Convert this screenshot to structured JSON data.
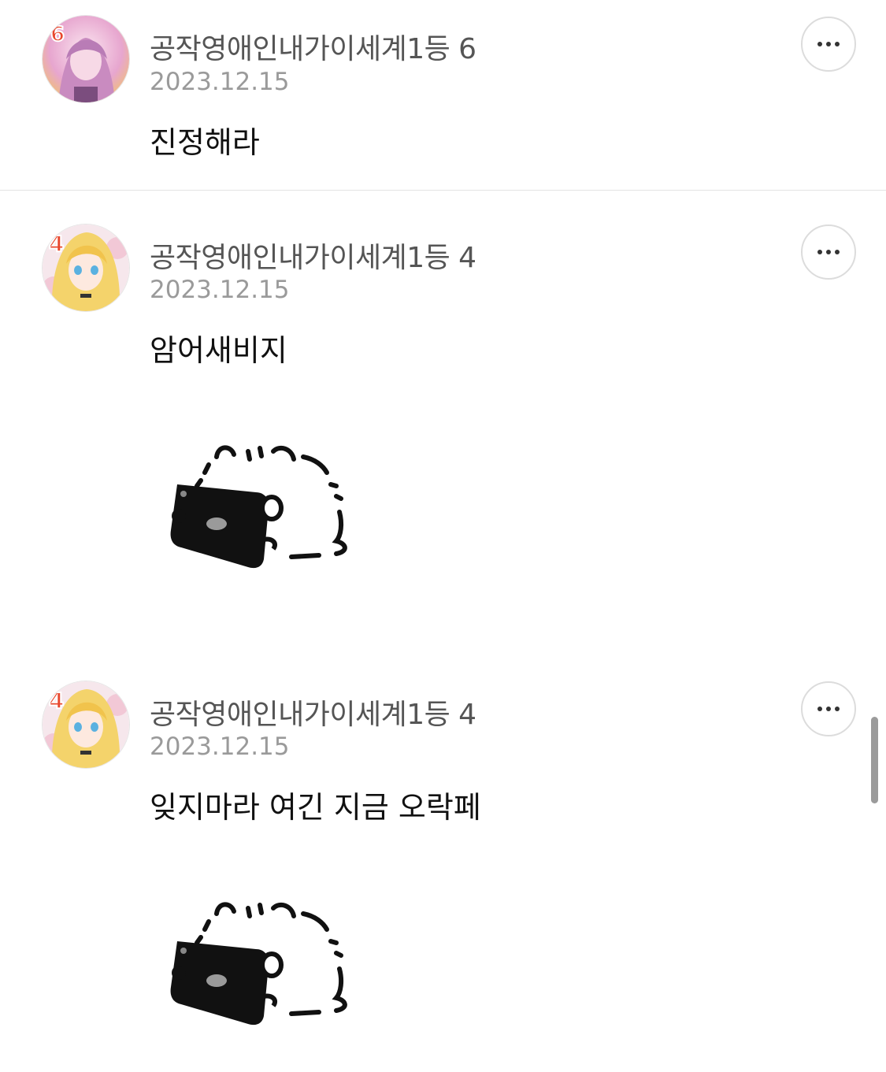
{
  "comments": [
    {
      "nickname": "공작영애인내가이세계1등 6",
      "date": "2023.12.15",
      "text": "진정해라",
      "avatar_badge": "6",
      "avatar_icon": "pink-haired-character-avatar",
      "sticker": null
    },
    {
      "nickname": "공작영애인내가이세계1등 4",
      "date": "2023.12.15",
      "text": "암어새비지",
      "avatar_badge": "4",
      "avatar_icon": "blonde-character-avatar",
      "sticker": "bear-with-phone-sticker"
    },
    {
      "nickname": "공작영애인내가이세계1등 4",
      "date": "2023.12.15",
      "text": "잊지마라 여긴 지금 오락페",
      "avatar_badge": "4",
      "avatar_icon": "blonde-character-avatar",
      "sticker": "bear-with-phone-sticker"
    }
  ],
  "colors": {
    "badge": "#e8472d",
    "date": "#9a9a9a",
    "nickname": "#555555"
  }
}
